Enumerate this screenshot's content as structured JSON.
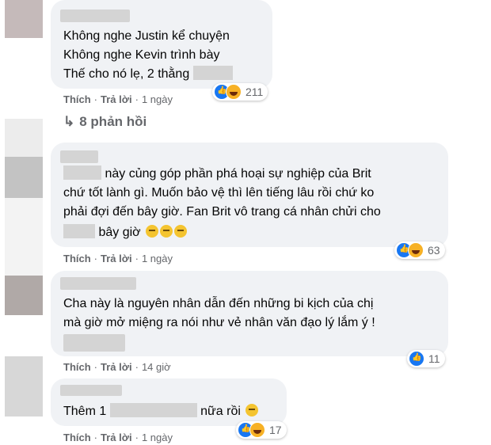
{
  "comments": [
    {
      "lines": [
        "Không nghe Justin kể chuyện",
        "Không nghe Kevin trình bày",
        "Thế cho nó lẹ, 2 thằng"
      ],
      "like_label": "Thích",
      "reply_label": "Trả lời",
      "time": "1 ngày",
      "reaction_count": "211",
      "reaction_icons": [
        "like-icon",
        "haha-icon"
      ]
    },
    {
      "line1_suffix": "này củng góp phần phá hoại sự nghiệp của Brit",
      "line2": "chứ tốt lành gì. Muốn bảo vệ thì lên tiếng lâu rồi chứ ko",
      "line3": "phải đợi đến bây giờ. Fan Brit vô trang cá nhân chửi cho",
      "line4_suffix": "bây giờ",
      "like_label": "Thích",
      "reply_label": "Trả lời",
      "time": "1 ngày",
      "reaction_count": "63",
      "reaction_icons": [
        "like-icon",
        "haha-icon"
      ]
    },
    {
      "lines": [
        "Cha này là nguyên nhân dẫn đến những bi kịch của chị",
        "mà giờ mở miệng ra nói như vẻ nhân văn đạo lý lắm ý !"
      ],
      "like_label": "Thích",
      "reply_label": "Trả lời",
      "time": "14 giờ",
      "reaction_count": "11",
      "reaction_icons": [
        "like-icon"
      ]
    },
    {
      "prefix": "Thêm 1",
      "suffix": "nữa rồi",
      "like_label": "Thích",
      "reply_label": "Trả lời",
      "time": "1 ngày",
      "reaction_count": "17",
      "reaction_icons": [
        "like-icon",
        "haha-icon"
      ]
    }
  ],
  "replies_link": "8 phản hồi",
  "colors": {
    "bubble": "#f0f2f5",
    "secondary_text": "#65676b",
    "like_blue": "#1877f2",
    "haha_yellow": "#f7b125"
  }
}
